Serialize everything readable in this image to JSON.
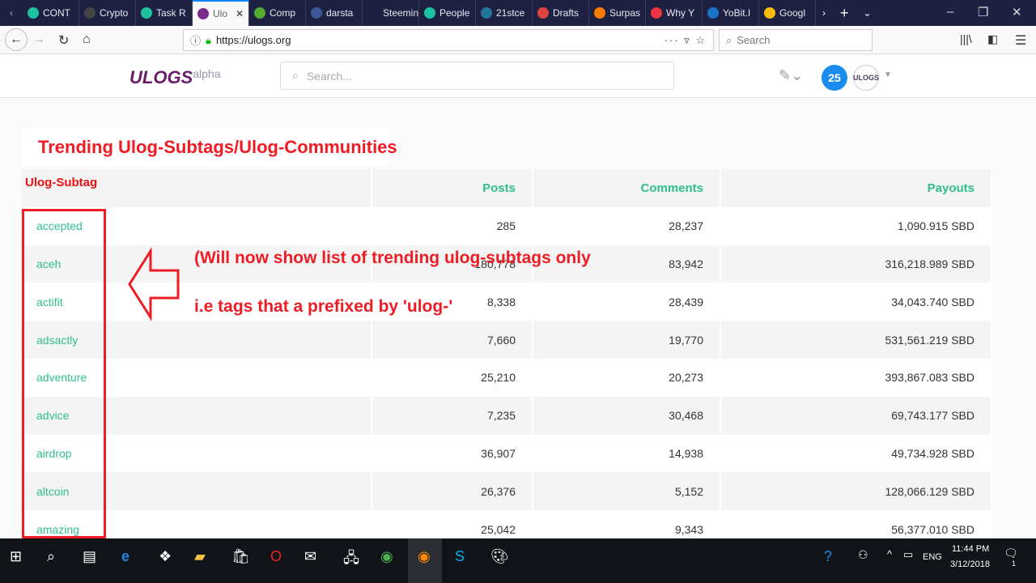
{
  "browser": {
    "tabs": [
      {
        "label": "CONT",
        "color": "#1fc2a0"
      },
      {
        "label": "Crypto",
        "color": "#444"
      },
      {
        "label": "Task R",
        "color": "#1fc2a0"
      },
      {
        "label": "Ulo",
        "color": "#7a2c8a",
        "active": true
      },
      {
        "label": "Comp",
        "color": "#5a3"
      },
      {
        "label": "darsta",
        "color": "#3b5998"
      },
      {
        "label": "Steeminvit",
        "color": ""
      },
      {
        "label": "People",
        "color": "#1fc2a0"
      },
      {
        "label": "21stce",
        "color": "#21759b"
      },
      {
        "label": "Drafts",
        "color": "#d44"
      },
      {
        "label": "Surpas",
        "color": "#f57d00"
      },
      {
        "label": "Why Y",
        "color": "#e34"
      },
      {
        "label": "YoBit.I",
        "color": "#1a73c8"
      },
      {
        "label": "Googl",
        "color": "#fbbc05"
      }
    ],
    "url": "https://ulogs.org",
    "search_placeholder": "Search"
  },
  "site": {
    "logo": "ULOGS",
    "logo_suffix": "alpha",
    "search_placeholder": "Search...",
    "notification_count": "25",
    "avatar": "ULOGS"
  },
  "page": {
    "title": "Trending Ulog-Subtags/Ulog-Communities",
    "columns": [
      "Ulog-Subtag",
      "Posts",
      "Comments",
      "Payouts"
    ],
    "rows": [
      [
        "accepted",
        "285",
        "28,237",
        "1,090.915 SBD"
      ],
      [
        "aceh",
        "180,778",
        "83,942",
        "316,218.989 SBD"
      ],
      [
        "actifit",
        "8,338",
        "28,439",
        "34,043.740 SBD"
      ],
      [
        "adsactly",
        "7,660",
        "19,770",
        "531,561.219 SBD"
      ],
      [
        "adventure",
        "25,210",
        "20,273",
        "393,867.083 SBD"
      ],
      [
        "advice",
        "7,235",
        "30,468",
        "69,743.177 SBD"
      ],
      [
        "airdrop",
        "36,907",
        "14,938",
        "49,734.928 SBD"
      ],
      [
        "altcoin",
        "26,376",
        "5,152",
        "128,066.129 SBD"
      ],
      [
        "amazing",
        "25,042",
        "9,343",
        "56,377.010 SBD"
      ]
    ],
    "annotation_line1": "(Will now show list of trending ulog-subtags only",
    "annotation_line2": "i.e tags that a prefixed by 'ulog-'"
  },
  "taskbar": {
    "time": "11:44 PM",
    "date": "3/12/2018",
    "lang": "ENG",
    "notifications": "1"
  }
}
